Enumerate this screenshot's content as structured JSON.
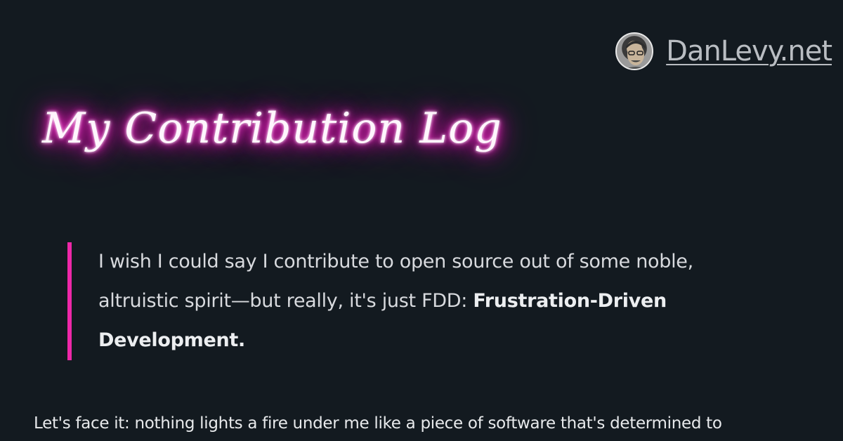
{
  "header": {
    "site_name": "DanLevy.net",
    "avatar_icon": "author-avatar"
  },
  "page": {
    "title": "My Contribution Log"
  },
  "quote": {
    "text_before": "I wish I could say I contribute to open source out of some noble, altruistic spirit—but really, it's just FDD: ",
    "emphasis": "Frustration-Driven Development.",
    "accent_color": "#ee27a8"
  },
  "article": {
    "first_line": "Let's face it: nothing lights a fire under me like a piece of software that's determined to"
  },
  "colors": {
    "background": "#131a20",
    "neon_glow": "#ff1fc6"
  }
}
